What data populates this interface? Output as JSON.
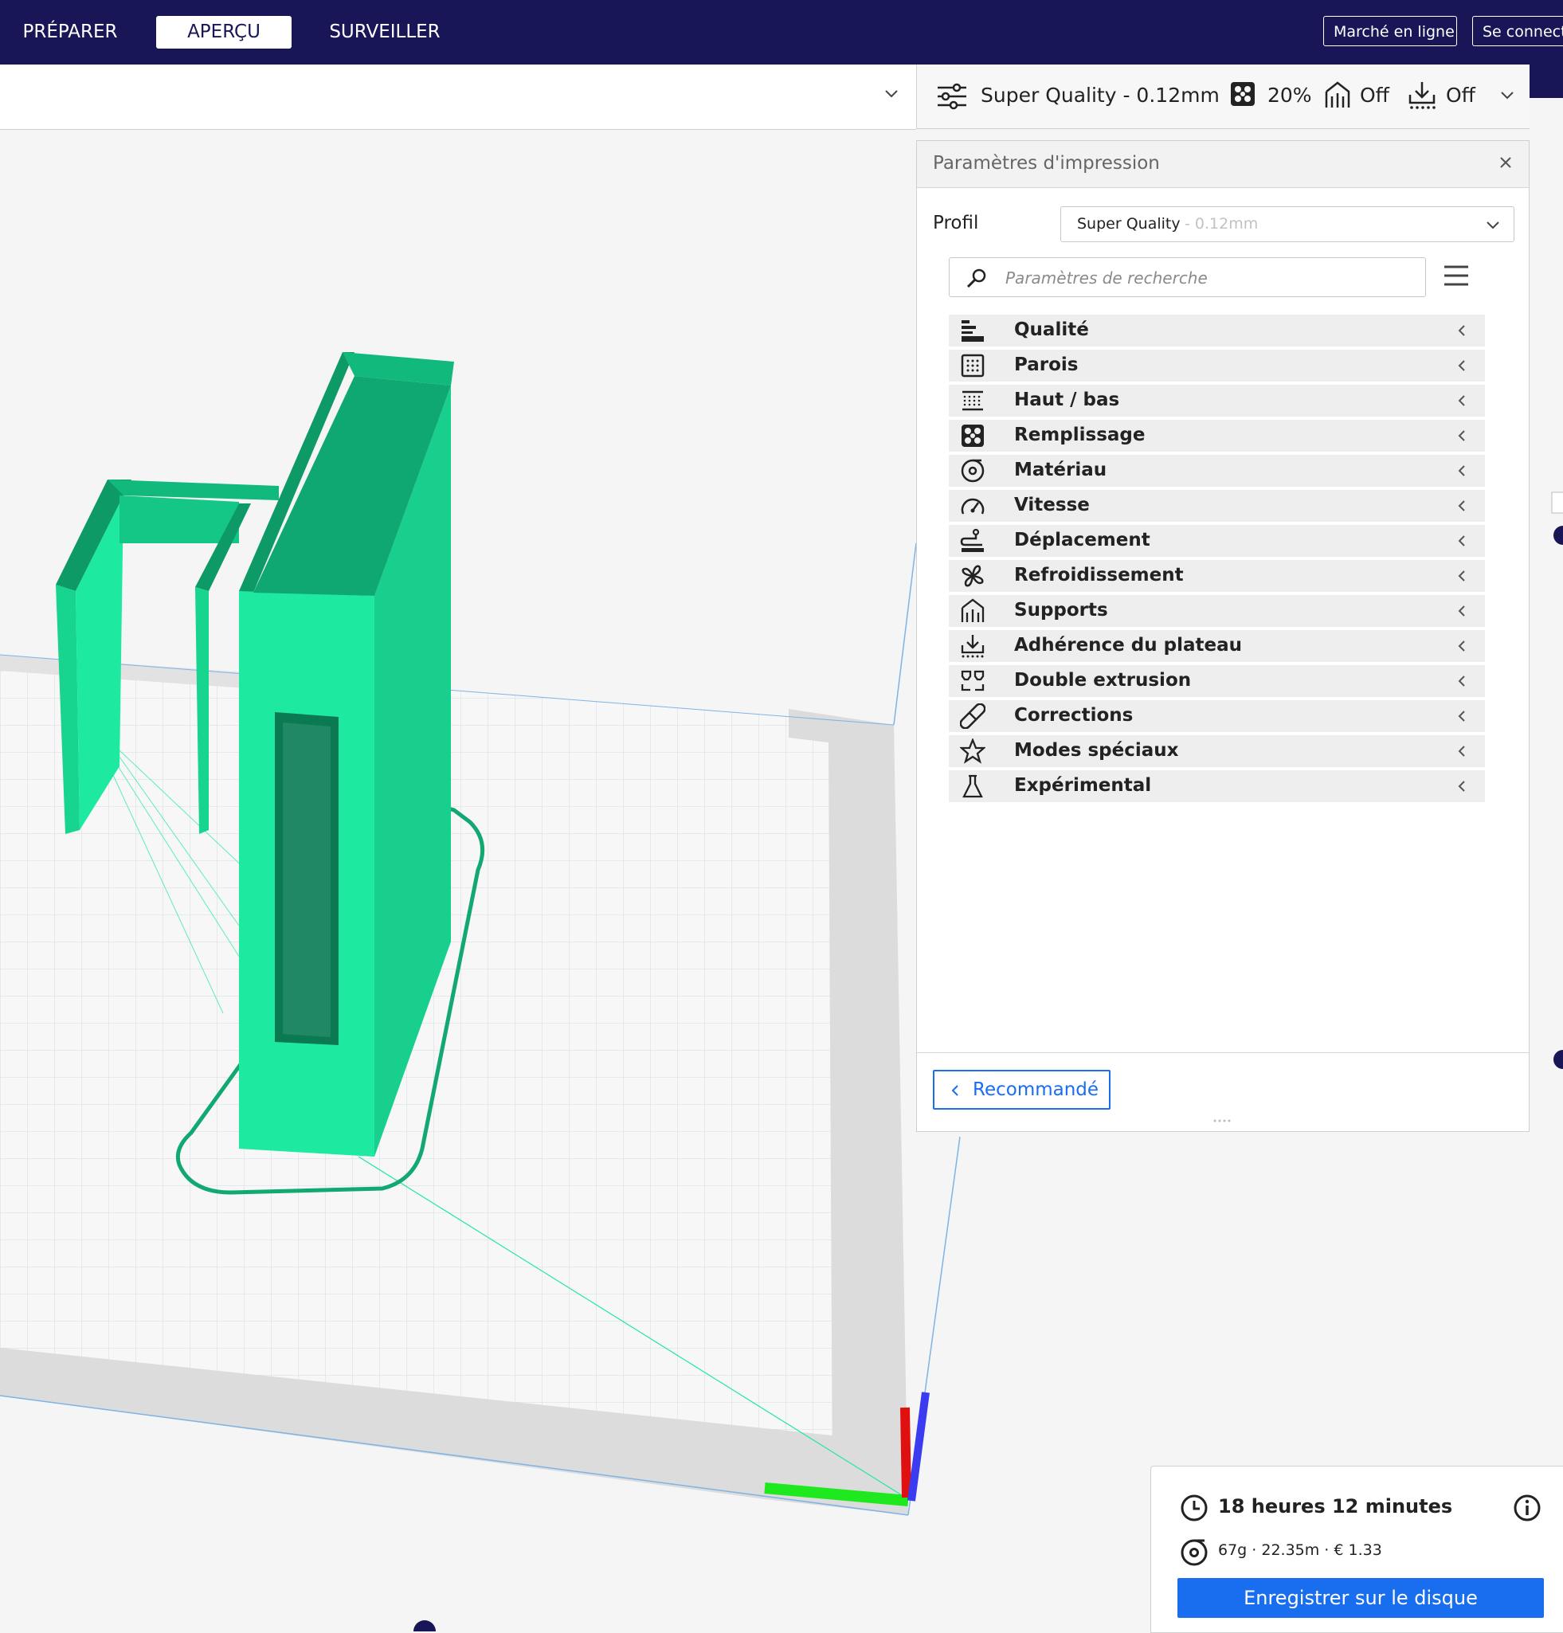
{
  "nav": {
    "tabs": [
      {
        "label": "PRÉPARER"
      },
      {
        "label": "APERÇU"
      },
      {
        "label": "SURVEILLER"
      }
    ],
    "marketplace_label": "Marché en ligne",
    "signin_label": "Se connecter"
  },
  "print_setup": {
    "profile": "Super Quality - 0.12mm",
    "infill": "20%",
    "support": "Off",
    "adhesion": "Off"
  },
  "settings_panel": {
    "title": "Paramètres d'impression",
    "profile_label": "Profil",
    "profile_name": "Super Quality",
    "profile_suffix": "- 0.12mm",
    "search_placeholder": "Paramètres de recherche",
    "categories": [
      {
        "label": "Qualité",
        "icon": "quality-icon"
      },
      {
        "label": "Parois",
        "icon": "walls-icon"
      },
      {
        "label": "Haut / bas",
        "icon": "top-bottom-icon"
      },
      {
        "label": "Remplissage",
        "icon": "infill-icon"
      },
      {
        "label": "Matériau",
        "icon": "material-icon"
      },
      {
        "label": "Vitesse",
        "icon": "speed-icon"
      },
      {
        "label": "Déplacement",
        "icon": "travel-icon"
      },
      {
        "label": "Refroidissement",
        "icon": "cooling-icon"
      },
      {
        "label": "Supports",
        "icon": "support-icon"
      },
      {
        "label": "Adhérence du plateau",
        "icon": "adhesion-icon"
      },
      {
        "label": "Double extrusion",
        "icon": "dual-extrusion-icon"
      },
      {
        "label": "Corrections",
        "icon": "fixes-icon"
      },
      {
        "label": "Modes spéciaux",
        "icon": "special-modes-icon"
      },
      {
        "label": "Expérimental",
        "icon": "experimental-icon"
      }
    ],
    "recommended_label": "Recommandé"
  },
  "job": {
    "time": "18 heures 12 minutes",
    "stats": "67g · 22.35m · € 1.33",
    "save_label": "Enregistrer sur le disque"
  },
  "colors": {
    "header_bg": "#191658",
    "accent": "#196ef0",
    "model": "#1de9a0",
    "model_dark": "#0d9a66"
  }
}
